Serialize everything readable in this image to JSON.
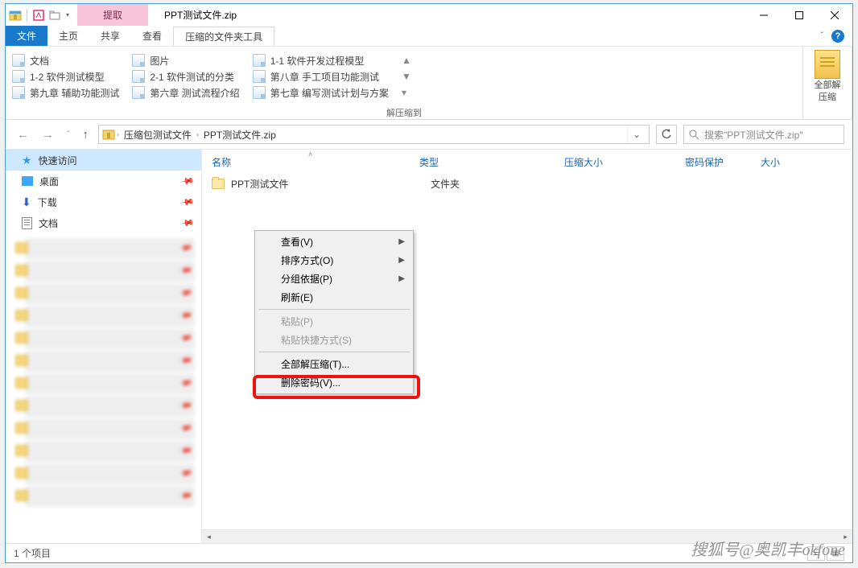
{
  "titlebar": {
    "context_label": "提取",
    "title": "PPT测试文件.zip"
  },
  "tabs": {
    "file": "文件",
    "home": "主页",
    "share": "共享",
    "view": "查看",
    "ctx": "压缩的文件夹工具"
  },
  "ribbon": {
    "extract_to_label": "解压缩到",
    "c1": [
      "文档",
      "1-2 软件测试模型",
      "第九章 辅助功能测试"
    ],
    "c2": [
      "图片",
      "2-1 软件测试的分类",
      "第六章 测试流程介绍"
    ],
    "c3": [
      "1-1 软件开发过程模型",
      "第八章 手工项目功能测试",
      "第七章 编写测试计划与方案"
    ],
    "extract_all_1": "全部解",
    "extract_all_2": "压缩"
  },
  "nav": {
    "bc1": "压缩包测试文件",
    "bc2": "PPT测试文件.zip",
    "search_placeholder": "搜索\"PPT测试文件.zip\""
  },
  "columns": {
    "name": "名称",
    "type": "类型",
    "csize": "压缩大小",
    "pwd": "密码保护",
    "size": "大小"
  },
  "rows": [
    {
      "name": "PPT测试文件",
      "type": "文件夹"
    }
  ],
  "sidebar": {
    "quick": "快速访问",
    "desktop": "桌面",
    "downloads": "下载",
    "documents": "文档"
  },
  "context_menu": {
    "view": "查看(V)",
    "sort": "排序方式(O)",
    "group": "分组依据(P)",
    "refresh": "刷新(E)",
    "paste": "粘贴(P)",
    "paste_shortcut": "粘贴快捷方式(S)",
    "extract_all": "全部解压缩(T)...",
    "remove_password": "删除密码(V)..."
  },
  "status": {
    "count": "1 个项目"
  },
  "watermark": "搜狐号@奥凯丰okfone"
}
